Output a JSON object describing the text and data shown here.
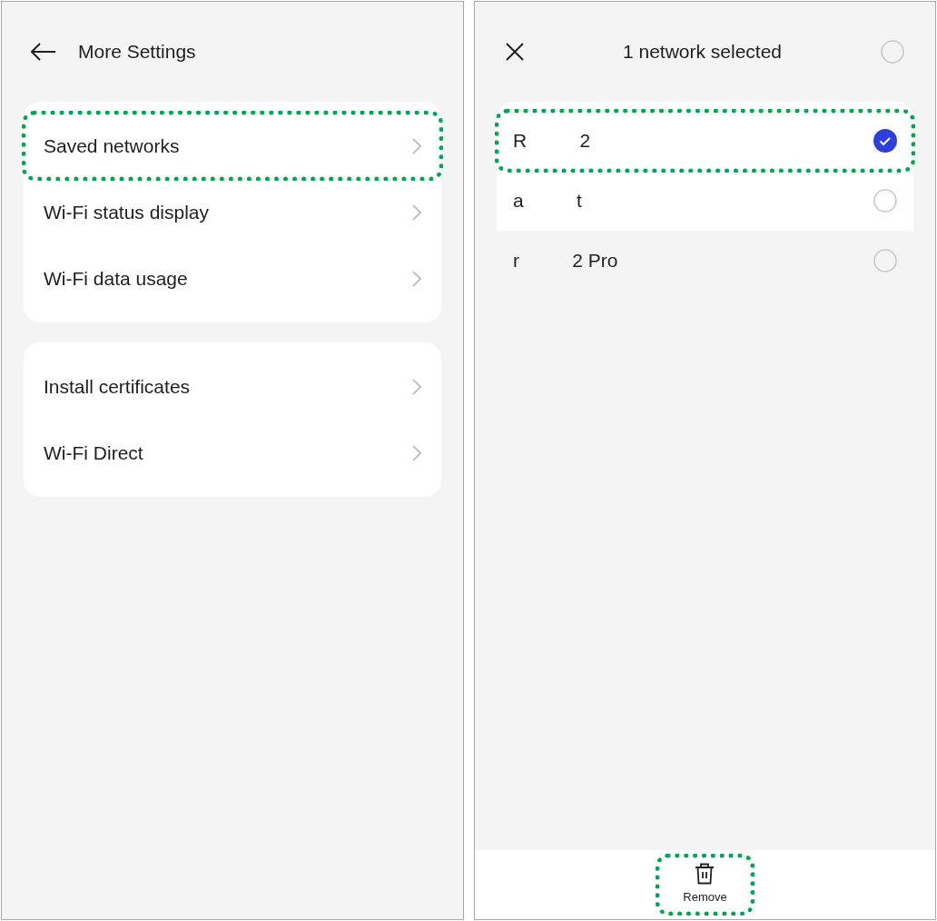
{
  "left": {
    "title": "More Settings",
    "groups": [
      {
        "items": [
          {
            "label": "Saved networks",
            "highlighted": true
          },
          {
            "label": "Wi-Fi status display",
            "highlighted": false
          },
          {
            "label": "Wi-Fi data usage",
            "highlighted": false
          }
        ]
      },
      {
        "items": [
          {
            "label": "Install certificates",
            "highlighted": false
          },
          {
            "label": "Wi-Fi Direct",
            "highlighted": false
          }
        ]
      }
    ]
  },
  "right": {
    "title": "1 network selected",
    "select_all": {
      "checked": false
    },
    "networks": [
      {
        "name_start": "R",
        "name_end": "2",
        "selected": true,
        "highlighted": true
      },
      {
        "name_start": "a",
        "name_end": "t",
        "selected": false,
        "highlighted": false
      }
    ],
    "more_networks": [
      {
        "name_start": "r",
        "name_end": "2 Pro",
        "selected": false,
        "highlighted": false
      }
    ],
    "remove": {
      "label": "Remove",
      "highlighted": true
    }
  }
}
